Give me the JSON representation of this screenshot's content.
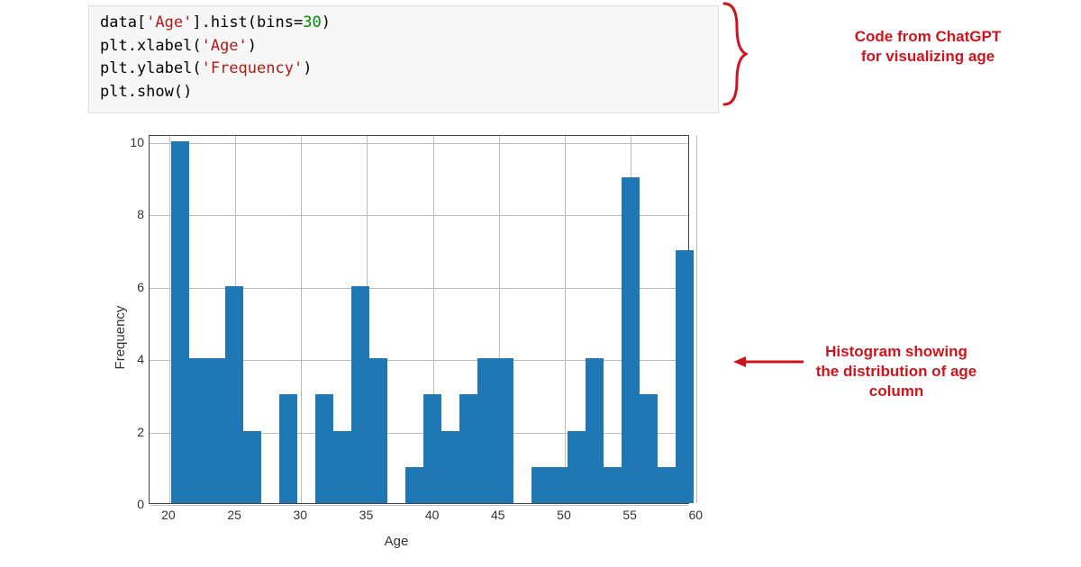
{
  "code": {
    "line1": {
      "a": "data[",
      "b": "'Age'",
      "c": "].hist(bins",
      "d": "=",
      "e": "30",
      "f": ")"
    },
    "line2": {
      "a": "plt.xlabel(",
      "b": "'Age'",
      "c": ")"
    },
    "line3": {
      "a": "plt.ylabel(",
      "b": "'Frequency'",
      "c": ")"
    },
    "line4": {
      "a": "plt.show()"
    }
  },
  "annotations": {
    "code_label_l1": "Code from ChatGPT",
    "code_label_l2": "for visualizing age",
    "hist_label_l1": "Histogram showing",
    "hist_label_l2": "the distribution of age",
    "hist_label_l3": "column"
  },
  "chart_data": {
    "type": "bar",
    "title": "",
    "xlabel": "Age",
    "ylabel": "Frequency",
    "xlim": [
      18.5,
      59.5
    ],
    "ylim": [
      0,
      10.2
    ],
    "xticks": [
      20,
      25,
      30,
      35,
      40,
      45,
      50,
      55,
      60
    ],
    "yticks": [
      0,
      2,
      4,
      6,
      8,
      10
    ],
    "bin_width": 1.3667,
    "categories_left_edge": [
      18.8,
      20.167,
      21.533,
      22.9,
      24.267,
      25.633,
      27.0,
      28.367,
      29.733,
      31.1,
      32.467,
      33.833,
      35.2,
      36.567,
      37.933,
      39.3,
      40.667,
      42.033,
      43.4,
      44.767,
      46.133,
      47.5,
      48.867,
      50.233,
      51.6,
      52.967,
      54.333,
      55.7,
      57.067,
      58.433
    ],
    "values": [
      0,
      10,
      4,
      4,
      6,
      2,
      0,
      3,
      0,
      3,
      2,
      6,
      4,
      0,
      1,
      3,
      2,
      3,
      4,
      4,
      0,
      1,
      1,
      2,
      4,
      1,
      9,
      3,
      1,
      7
    ]
  }
}
